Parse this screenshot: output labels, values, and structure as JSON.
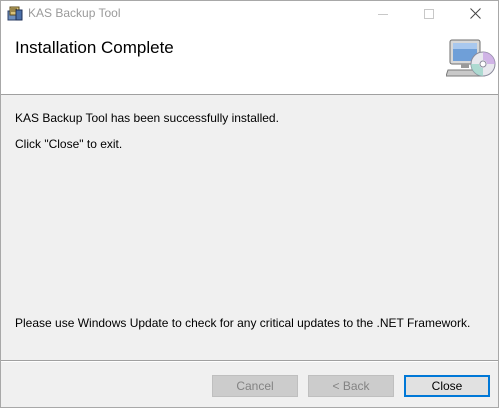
{
  "window": {
    "title": "KAS Backup Tool"
  },
  "titlebar": {
    "minimize_icon": "minimize-icon",
    "maximize_icon": "maximize-icon",
    "close_icon": "close-icon"
  },
  "banner": {
    "title": "Installation Complete",
    "graphic": "computer-cd-icon"
  },
  "body": {
    "line1": "KAS Backup Tool has been successfully installed.",
    "line2": "Click \"Close\" to exit.",
    "line3": "Please use Windows Update to check for any critical updates to the .NET Framework."
  },
  "buttons": {
    "cancel_label": "Cancel",
    "back_label": "< Back",
    "close_label": "Close"
  },
  "colors": {
    "accent": "#0078d7",
    "window_bg": "#f0f0f0",
    "banner_bg": "#ffffff",
    "disabled_text": "#838383"
  }
}
